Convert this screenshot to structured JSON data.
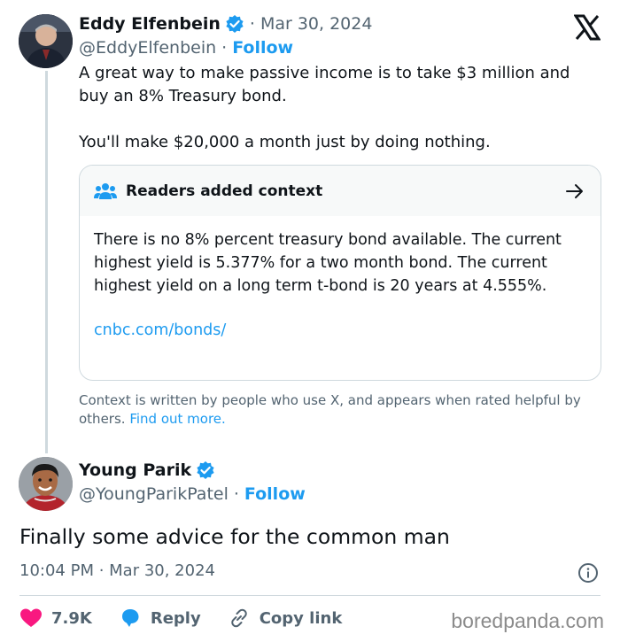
{
  "tweet": {
    "author": {
      "name": "Eddy Elfenbein",
      "handle": "@EddyElfenbein",
      "follow_label": "Follow"
    },
    "separator": "·",
    "date": "Mar 30, 2024",
    "text_lines": [
      "A great way to make passive income is to take $3 million and buy an 8% Treasury bond.",
      "You'll make $20,000 a month just by doing nothing."
    ],
    "community_note": {
      "title": "Readers added context",
      "body": "There is no 8% percent treasury bond available. The current highest  yield is 5.377% for a two month bond. The current highest yield on a long term t-bond is 20 years at 4.555%.",
      "link": "cnbc.com/bonds/"
    },
    "context_footer": {
      "text": "Context is written by people who use X, and appears when rated helpful by others.",
      "link": "Find out more."
    }
  },
  "reply": {
    "author": {
      "name": "Young Parik",
      "handle": "@YoungParikPatel",
      "follow_label": "Follow"
    },
    "text": "Finally some advice for the common man",
    "timestamp": "10:04 PM · Mar 30, 2024",
    "actions": {
      "likes": "7.9K",
      "reply_label": "Reply",
      "copy_label": "Copy link"
    }
  },
  "watermark": "boredpanda.com",
  "colors": {
    "accent": "#1d9bf0",
    "like": "#f91880",
    "text": "#0f1419",
    "muted": "#536471",
    "border": "#cfd9de"
  },
  "icons": [
    "x-logo-icon",
    "verified-badge-icon",
    "readers-context-icon",
    "arrow-right-icon",
    "info-icon",
    "heart-icon",
    "reply-icon",
    "link-icon"
  ]
}
